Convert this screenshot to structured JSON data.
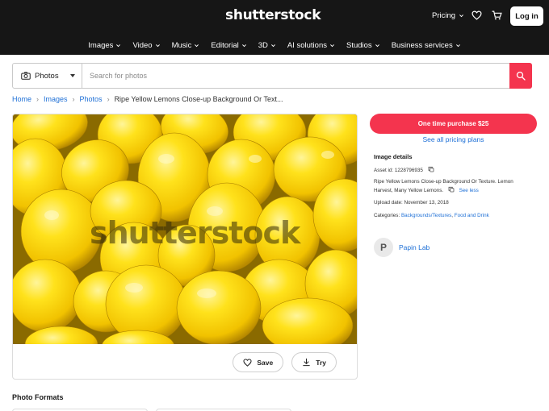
{
  "header": {
    "logo": "shutterstock",
    "pricing_label": "Pricing",
    "login_label": "Log in",
    "nav": [
      {
        "label": "Images"
      },
      {
        "label": "Video"
      },
      {
        "label": "Music"
      },
      {
        "label": "Editorial"
      },
      {
        "label": "3D"
      },
      {
        "label": "AI solutions"
      },
      {
        "label": "Studios"
      },
      {
        "label": "Business services"
      }
    ],
    "icons": [
      "chevron-down-icon",
      "heart-icon",
      "cart-icon"
    ]
  },
  "search": {
    "type_label": "Photos",
    "placeholder": "Search for photos"
  },
  "breadcrumb": {
    "items": [
      "Home",
      "Images",
      "Photos"
    ],
    "current": "Ripe Yellow Lemons Close-up Background Or Text..."
  },
  "image": {
    "watermark": "shutterstock",
    "save_label": "Save",
    "try_label": "Try"
  },
  "formats": {
    "title": "Photo Formats"
  },
  "purchase": {
    "buy_label": "One time purchase $25",
    "plans_label": "See all pricing plans"
  },
  "details": {
    "title": "Image details",
    "asset_id": "Asset id: 1228796935",
    "description_line1": "Ripe Yellow Lemons Close-up Background Or Texture. Lemon",
    "description_line2": "Harvest, Many Yellow Lemons.",
    "see_less": "See less",
    "upload_date": "Upload date: November 13, 2018",
    "categories_label": "Categories:",
    "categories": [
      "Backgrounds/Textures",
      "Food and Drink"
    ]
  },
  "author": {
    "initial": "P",
    "name": "Papin Lab"
  },
  "colors": {
    "header_bg": "#161616",
    "accent_red": "#f4344e",
    "link_blue": "#1d6fd6",
    "lemon_yellow": "#f2c300"
  }
}
